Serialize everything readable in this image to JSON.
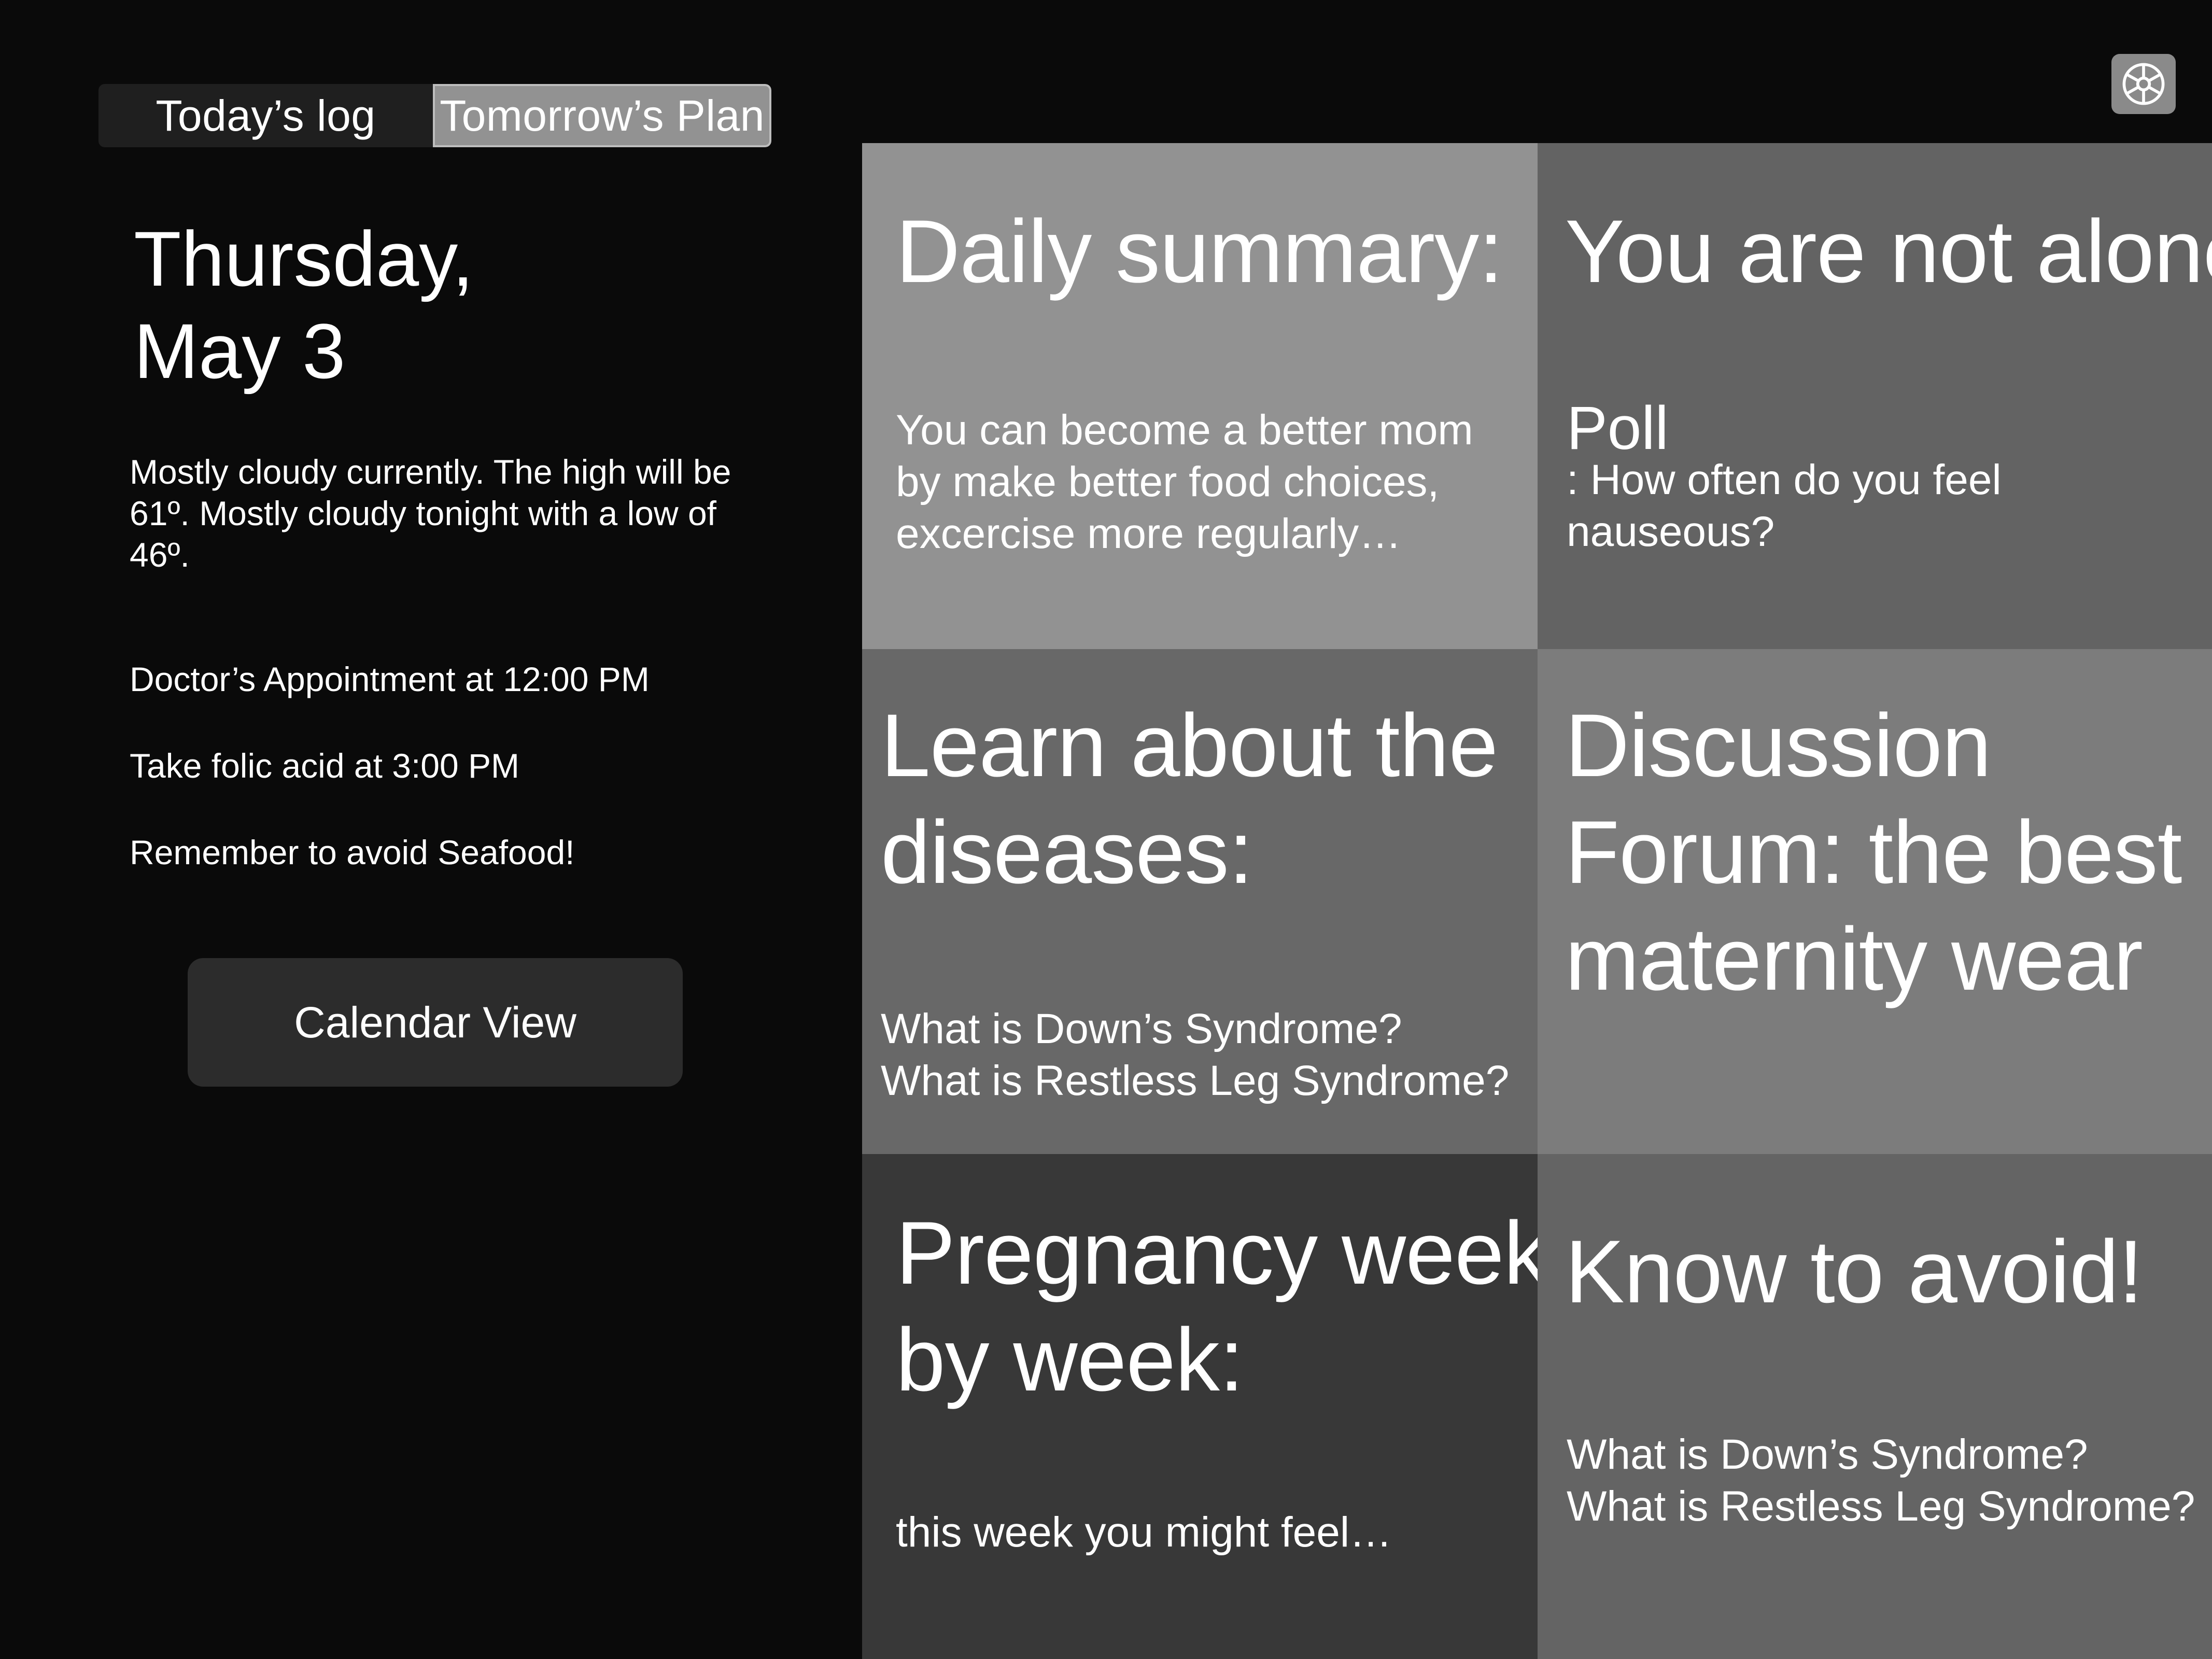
{
  "header": {
    "tabs": [
      {
        "label": "Today’s log",
        "active": false
      },
      {
        "label": "Tomorrow’s Plan",
        "active": true
      }
    ],
    "settings_icon": "gear-icon"
  },
  "day": {
    "weekday": "Thursday,",
    "date": "May 3",
    "weather_lines": [
      "Mostly cloudy currently. The high will be",
      "61º. Mostly cloudy tonight with a low of",
      "46º."
    ],
    "reminders": [
      "Doctor’s Appointment at 12:00 PM",
      "Take folic acid at 3:00 PM",
      "Remember to avoid Seafood!"
    ],
    "calendar_button": "Calendar View"
  },
  "tiles": {
    "daily_summary": {
      "title": "Daily summary:",
      "body_lines": [
        "You can become a better mom",
        "by make better food choices,",
        "excercise more regularly…"
      ],
      "color": "#929292"
    },
    "not_alone": {
      "title": "You are not alone",
      "poll_label": "Poll",
      "body_line1": ": How often do you feel",
      "body_line2": "nauseous?",
      "color": "#636363"
    },
    "learn": {
      "title_lines": [
        "Learn about the",
        "diseases:"
      ],
      "body_lines": [
        "What is Down’s Syndrome?",
        "What is Restless Leg Syndrome?"
      ],
      "color": "#686868"
    },
    "forum": {
      "title_lines": [
        "Discussion",
        "Forum: the best",
        "maternity wear"
      ],
      "color": "#7c7c7c"
    },
    "pregnancy": {
      "title_lines": [
        "Pregnancy week",
        "by week:"
      ],
      "body": "this week you might feel…",
      "color": "#383838"
    },
    "avoid": {
      "title": "Know to avoid!",
      "body_lines": [
        "What is Down’s Syndrome?",
        "What is Restless Leg Syndrome?"
      ],
      "color": "#646464"
    }
  }
}
